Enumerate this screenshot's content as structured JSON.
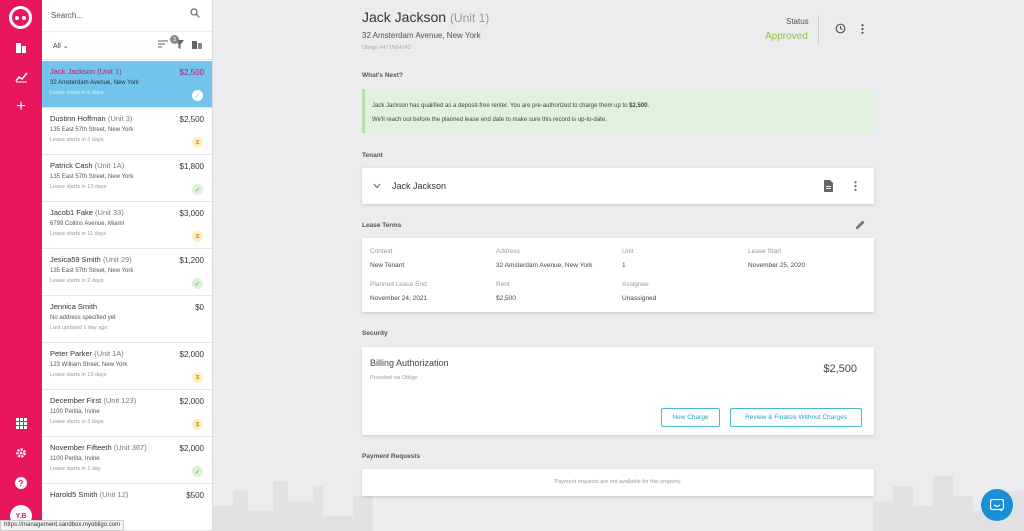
{
  "rail": {
    "avatar_initials": "Y.B"
  },
  "search": {
    "placeholder": "Search..."
  },
  "filters": {
    "scope": "All",
    "filter_count": "3"
  },
  "leases": [
    {
      "name": "Jack Jackson",
      "unit": "(Unit 1)",
      "price": "$2,500",
      "address": "32 Amsterdam Avenue, New York",
      "status_text": "Lease starts in 6 days",
      "selected": true,
      "state": "done"
    },
    {
      "name": "Dustinn Hoffman",
      "unit": "(Unit 3)",
      "price": "$2,500",
      "address": "135 East 57th Street, New York",
      "status_text": "Lease starts in 3 days",
      "state": "wait"
    },
    {
      "name": "Patrick Cash",
      "unit": "(Unit 1A)",
      "price": "$1,800",
      "address": "135 East 57th Street, New York",
      "status_text": "Lease starts in 13 days",
      "state": "ok"
    },
    {
      "name": "Jacob1 Fake",
      "unit": "(Unit 33)",
      "price": "$3,000",
      "address": "6799 Collins Avenue, Miami",
      "status_text": "Lease starts in 11 days",
      "state": "wait"
    },
    {
      "name": "Jesica59 Smith",
      "unit": "(Unit 29)",
      "price": "$1,200",
      "address": "135 East 57th Street, New York",
      "status_text": "Lease starts in 2 days",
      "state": "ok"
    },
    {
      "name": "Jennica Smith",
      "unit": "",
      "price": "$0",
      "address": "No address specified yet",
      "status_text": "Last updated 1 day ago",
      "state": "none"
    },
    {
      "name": "Peter Parker",
      "unit": "(Unit 1A)",
      "price": "$2,000",
      "address": "123 William Street, New York",
      "status_text": "Lease starts in 13 days",
      "state": "wait"
    },
    {
      "name": "December First",
      "unit": "(Unit 123)",
      "price": "$2,000",
      "address": "1100 Perlita, Irvine",
      "status_text": "Lease starts in 3 days",
      "state": "wait"
    },
    {
      "name": "November Fifteeth",
      "unit": "(Unit 367)",
      "price": "$2,000",
      "address": "1100 Perlita, Irvine",
      "status_text": "Lease starts in 1 day",
      "state": "ok"
    },
    {
      "name": "Harold5 Smith",
      "unit": "(Unit 12)",
      "price": "$500",
      "address": "",
      "status_text": "",
      "state": "none"
    }
  ],
  "statusbar": {
    "url": "https://management.sandbox.myobligo.com"
  },
  "detail": {
    "name": "Jack Jackson",
    "unit": "(Unit 1)",
    "address": "32 Amsterdam Avenue, New York",
    "record_id": "Obligo #471N64242",
    "status_label": "Status",
    "status_value": "Approved",
    "whats_next_heading": "What's Next?",
    "alert_line1_pre": "Jack Jackson has qualified as a deposit-free renter. You are pre-authorized to charge them up to ",
    "alert_line1_amount": "$2,500",
    "alert_line1_post": ".",
    "alert_line2": "We'll reach out before the planned lease end date to make sure this record is up-to-date.",
    "tenant_heading": "Tenant",
    "tenant_name": "Jack Jackson",
    "lease_terms_heading": "Lease Terms",
    "lease": {
      "context_label": "Context",
      "context": "New Tenant",
      "address_label": "Address",
      "address": "32 Amsterdam Avenue, New York",
      "unit_label": "Unit",
      "unit": "1",
      "start_label": "Lease Start",
      "start": "November 25, 2020",
      "end_label": "Planned Lease End",
      "end": "November 24, 2021",
      "rent_label": "Rent",
      "rent": "$2,500",
      "assignee_label": "Assignee",
      "assignee": "Unassigned"
    },
    "security_heading": "Security",
    "billing_title": "Billing Authorization",
    "billing_sub": "Provided via Obligo",
    "billing_amount": "$2,500",
    "new_charge": "New Charge",
    "review_finalize": "Review & Finalize Without Charges",
    "payment_heading": "Payment Requests",
    "payment_empty": "Payment requests are not available for this property."
  },
  "colors": {
    "brand": "#e8175d",
    "selected": "#73c4ec",
    "approved": "#8bc34a",
    "accent": "#2ea3c2"
  }
}
